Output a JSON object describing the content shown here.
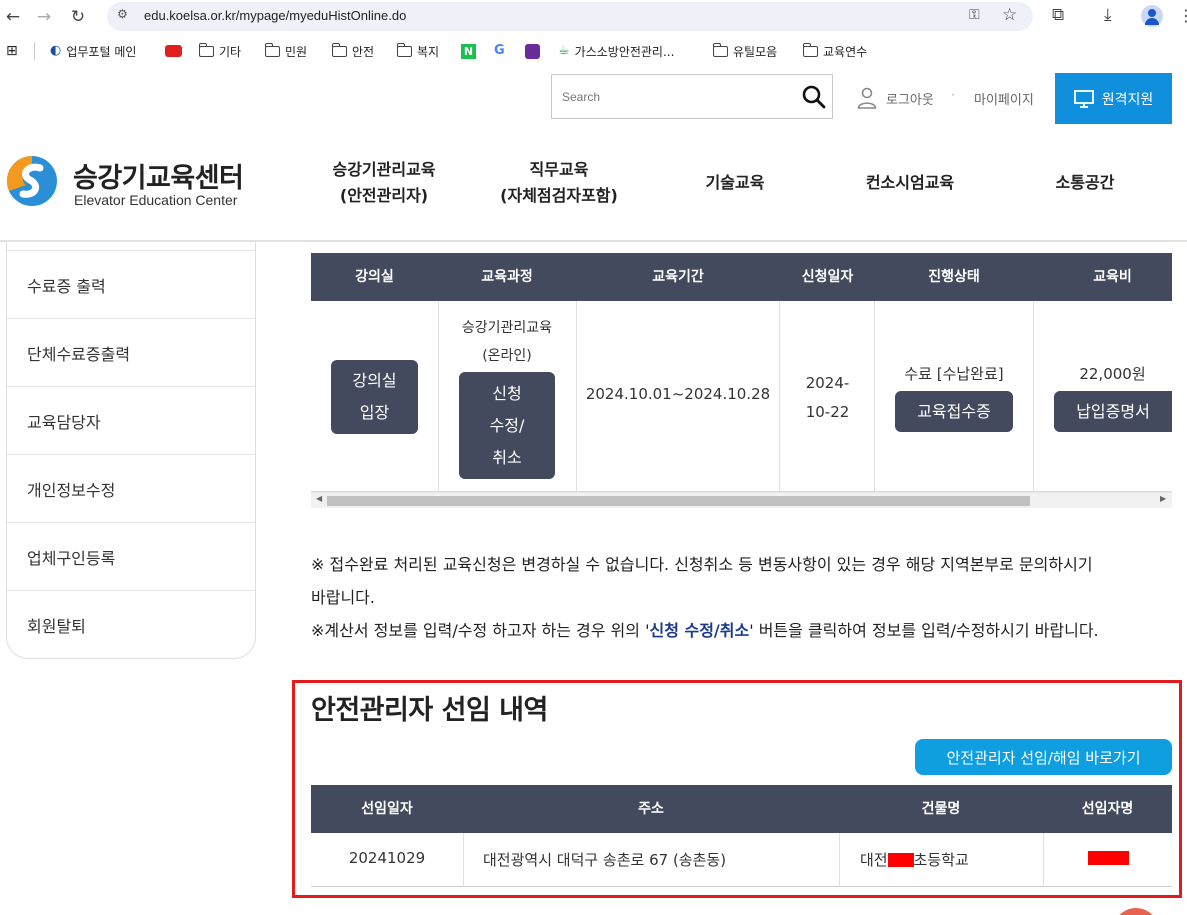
{
  "browser": {
    "url": "edu.koelsa.or.kr/mypage/myeduHistOnline.do",
    "bookmarks": [
      {
        "label": "업무포털 메인",
        "icon": "globe-icon"
      },
      {
        "label": "",
        "icon": "youtube-icon"
      },
      {
        "label": "기타",
        "icon": "folder-icon"
      },
      {
        "label": "민원",
        "icon": "folder-icon"
      },
      {
        "label": "안전",
        "icon": "folder-icon"
      },
      {
        "label": "복지",
        "icon": "folder-icon"
      },
      {
        "label": "N",
        "icon": "naver-icon"
      },
      {
        "label": "G",
        "icon": "google-icon"
      },
      {
        "label": "",
        "icon": "app-icon"
      },
      {
        "label": "가스소방안전관리...",
        "icon": "leaf-icon"
      },
      {
        "label": "유틸모음",
        "icon": "folder-icon"
      },
      {
        "label": "교육연수",
        "icon": "folder-icon"
      }
    ]
  },
  "util": {
    "search_placeholder": "Search",
    "logout": "로그아웃",
    "separator": "·",
    "mypage": "마이페이지",
    "remote": "원격지원"
  },
  "logo": {
    "name_ko": "승강기교육센터",
    "name_en": "Elevator Education Center"
  },
  "gnb": [
    {
      "line1": "승강기관리교육",
      "line2": "(안전관리자)"
    },
    {
      "line1": "직무교육",
      "line2": "(자체점검자포함)"
    },
    {
      "line1": "기술교육",
      "line2": ""
    },
    {
      "line1": "컨소시엄교육",
      "line2": ""
    },
    {
      "line1": "소통공간",
      "line2": ""
    }
  ],
  "sidebar": {
    "items": [
      "수료증 출력",
      "단체수료증출력",
      "교육담당자",
      "개인정보수정",
      "업체구인등록",
      "회원탈퇴"
    ]
  },
  "course_table": {
    "headers": [
      "강의실",
      "교육과정",
      "교육기간",
      "신청일자",
      "진행상태",
      "교육비"
    ],
    "row": {
      "classroom_btn": [
        "강의실",
        "입장"
      ],
      "course_line1": "승강기관리교육",
      "course_line2": "(온라인)",
      "modify_btn": [
        "신청",
        "수정/",
        "취소"
      ],
      "period": "2024.10.01~2024.10.28",
      "apply_date_1": "2024-",
      "apply_date_2": "10-22",
      "status": "수료 [수납완료]",
      "receipt_btn": "교육접수증",
      "fee": "22,000원",
      "payment_btn": "납입증명서"
    }
  },
  "notices": {
    "line1": "※ 접수완료 처리된 교육신청은 변경하실 수 없습니다. 신청취소 등 변동사항이 있는 경우 해당 지역본부로 문의하시기",
    "line2": "바랍니다.",
    "line3_pre": "※계산서 정보를 입력/수정 하고자 하는 경우 위의 '",
    "line3_hl": "신청 수정/취소",
    "line3_post": "' 버튼을 클릭하여 정보를 입력/수정하시기 바랍니다."
  },
  "appointment": {
    "title": "안전관리자 선임 내역",
    "shortcut_btn": "안전관리자 선임/해임 바로가기",
    "headers": [
      "선임일자",
      "주소",
      "건물명",
      "선임자명"
    ],
    "row": {
      "date": "20241029",
      "address": "대전광역시 대덕구 송촌로 67 (송촌동)",
      "building_pre": "대전",
      "building_post": "초등학교"
    }
  },
  "colors": {
    "table_header": "#434a5e",
    "accent_blue": "#0f8fdc",
    "highlight_red": "#e31b1b"
  }
}
